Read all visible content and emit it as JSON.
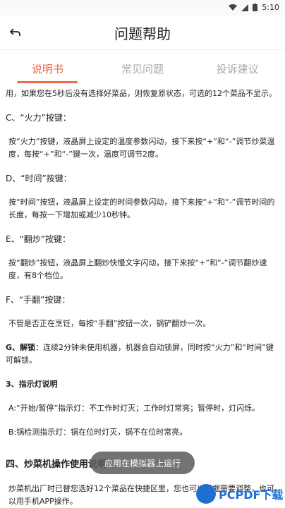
{
  "status_bar": {
    "time": "5:10"
  },
  "header": {
    "title": "问题帮助"
  },
  "tabs": [
    {
      "label": "说明书"
    },
    {
      "label": "常见问题"
    },
    {
      "label": "投诉建议"
    }
  ],
  "content": {
    "intro_line": "用，如果您在5秒后没有选择好菜品，则恢复原状态，可选的12个菜品不显示。",
    "c_heading": "C、“火力”按键：",
    "c_body": "按“火力”按键，液晶屏上设定的温度参数闪动，接下来按“+”和“-”调节炒菜温度，每按“+”和“-”键一次，温度可调节2度。",
    "d_heading": "D、“时间”按键：",
    "d_body": "按“时间”按钮，液晶屏上设定的时间参数闪动，接下来按“+”和“-”调节时间的长度，每按一下增加或减少10秒钟。",
    "e_heading": "E、“翻炒”按键：",
    "e_body": "按“翻炒”按钮，液晶屏上翻炒快慢文字闪动，接下来按“+”和“-”调节翻炒速度，有8个档位。",
    "f_heading": "F、“手翻”按键：",
    "f_body": "不管是否正在烹饪，每按“手翻”按钮一次，锅铲翻炒一次。",
    "g_label": "G、解锁",
    "g_body": "：连续2分钟未使用机器，机器会自动锁屏，同时按“火力”和“时间”键可解锁。",
    "section3_title": "3、指示灯说明",
    "a_item": "A:“开始/暂停”指示灯：不工作时灯灭；工作时灯常亮；暂停时，灯闪烁。",
    "b_item": "B:锅检测指示灯：锅在位时灯灭，锅不在位时常亮。",
    "section4_title": "四、炒菜机操作使用说明",
    "section4_body": "炒菜机出厂时已替您选好12个菜品在快捷区里，您也可以根据需要调整，也可以用手机APP操作。"
  },
  "toast": {
    "text": "应用在模拟器上运行"
  },
  "watermark": {
    "text": "PCPDF下载"
  },
  "colors": {
    "accent": "#ef6b45",
    "watermark": "#1e6fd1"
  }
}
